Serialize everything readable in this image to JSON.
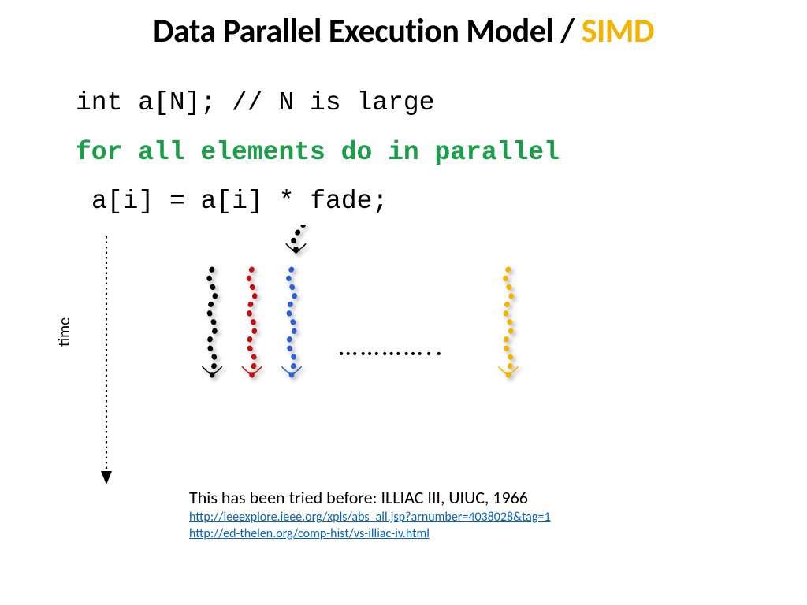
{
  "title": {
    "part1": "Data Parallel Execution Model / ",
    "part2": "SIMD"
  },
  "code": {
    "line1": "int a[N]; // N is large",
    "line2": "for all elements do in parallel",
    "line3": "a[i] = a[i] * fade;"
  },
  "axis_label": "time",
  "ellipsis": "…………..",
  "footnote": {
    "text": "This has been tried before: ILLIAC III, UIUC, 1966",
    "link1": "http://ieeexplore.ieee.org/xpls/abs_all.jsp?arnumber=4038028&tag=1",
    "link2": "http://ed-thelen.org/comp-hist/vs-illiac-iv.html"
  },
  "colors": {
    "thread1": "#000000",
    "thread2": "#c10e0e",
    "thread3": "#2d5fd6",
    "thread4": "#f3b400"
  }
}
